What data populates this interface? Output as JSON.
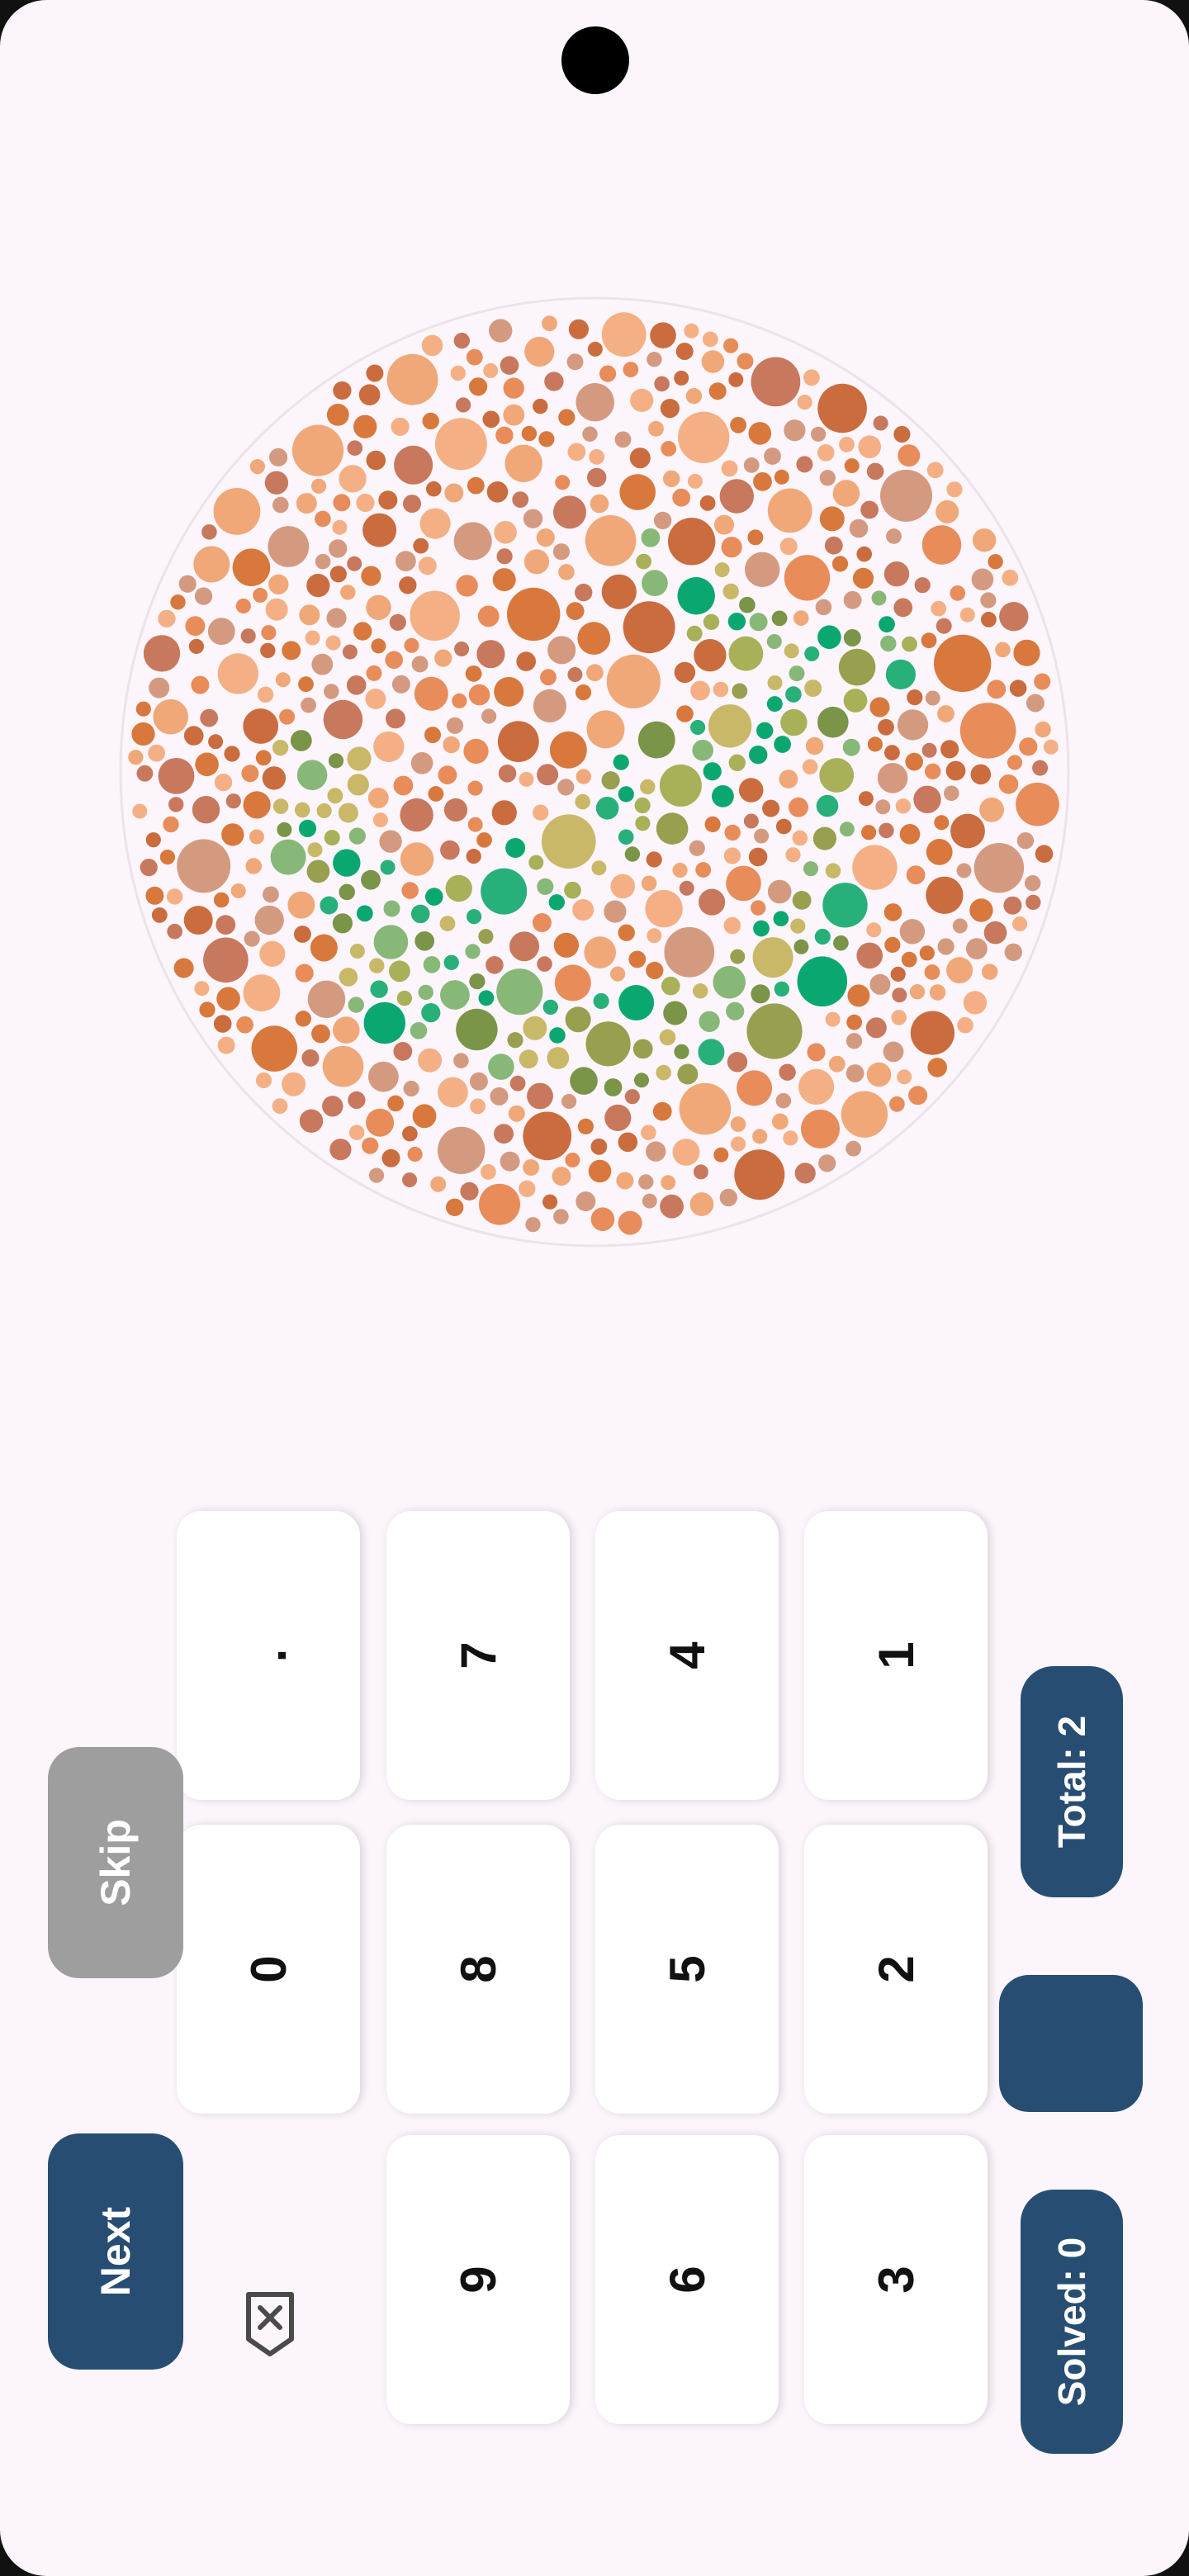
{
  "keypad": {
    "keys": [
      "1",
      "2",
      "3",
      "4",
      "5",
      "6",
      "7",
      "8",
      "9",
      ".",
      "0"
    ]
  },
  "score": {
    "total_label": "Total: 2",
    "solved_label": "Solved: 0"
  },
  "answer": {
    "value": ""
  },
  "actions": {
    "skip_label": "Skip",
    "next_label": "Next"
  },
  "icons": {
    "backspace": "backspace-icon"
  },
  "colors": {
    "background": "#fcf5fc",
    "accent": "#274e72",
    "skip": "#9e9e9e",
    "key": "#ffffff",
    "plate_background": [
      "#f0a878",
      "#e88c5a",
      "#d8783c",
      "#ca6c3e",
      "#f4b084",
      "#c8785c",
      "#d49a80"
    ],
    "plate_figure": [
      "#0aa870",
      "#28b07a",
      "#88b878",
      "#a8b058",
      "#98a050",
      "#c8b868",
      "#7a9448"
    ]
  }
}
